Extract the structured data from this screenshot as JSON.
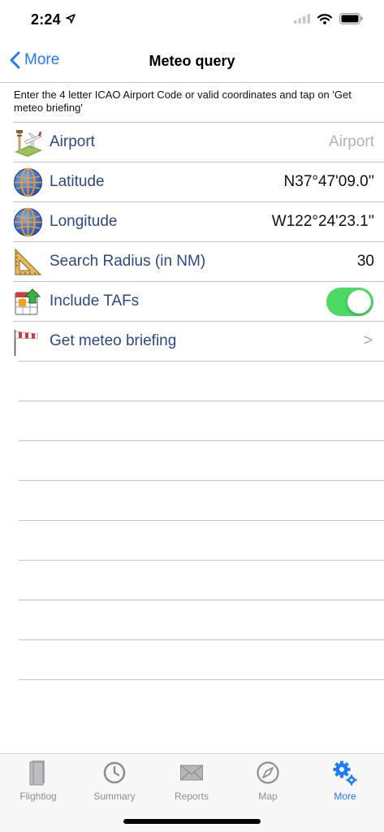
{
  "status_bar": {
    "time": "2:24"
  },
  "nav": {
    "back_label": "More",
    "title": "Meteo query"
  },
  "instructions": "Enter the 4 letter ICAO Airport Code or valid coordinates and tap on 'Get meteo briefing'",
  "rows": [
    {
      "label": "Airport",
      "value": "",
      "placeholder": "Airport",
      "icon": "airport-icon"
    },
    {
      "label": "Latitude",
      "value": "N37°47'09.0''",
      "icon": "globe-icon"
    },
    {
      "label": "Longitude",
      "value": "W122°24'23.1''",
      "icon": "globe-icon"
    },
    {
      "label": "Search Radius (in NM)",
      "value": "30",
      "icon": "ruler-triangle-icon"
    },
    {
      "label": "Include TAFs",
      "toggle_on": true,
      "icon": "calendar-arrow-icon"
    },
    {
      "label": "Get meteo briefing",
      "chevron": ">",
      "icon": "windsock-icon"
    }
  ],
  "tabs": [
    {
      "label": "Flightlog",
      "icon": "book-icon",
      "active": false
    },
    {
      "label": "Summary",
      "icon": "clock-icon",
      "active": false
    },
    {
      "label": "Reports",
      "icon": "envelope-icon",
      "active": false
    },
    {
      "label": "Map",
      "icon": "compass-icon",
      "active": false
    },
    {
      "label": "More",
      "icon": "gears-icon",
      "active": true
    }
  ],
  "colors": {
    "accent": "#1a7dfb",
    "label_blue": "#2a4a86",
    "toggle_green": "#4cd964",
    "tab_inactive": "#8e8e93"
  }
}
